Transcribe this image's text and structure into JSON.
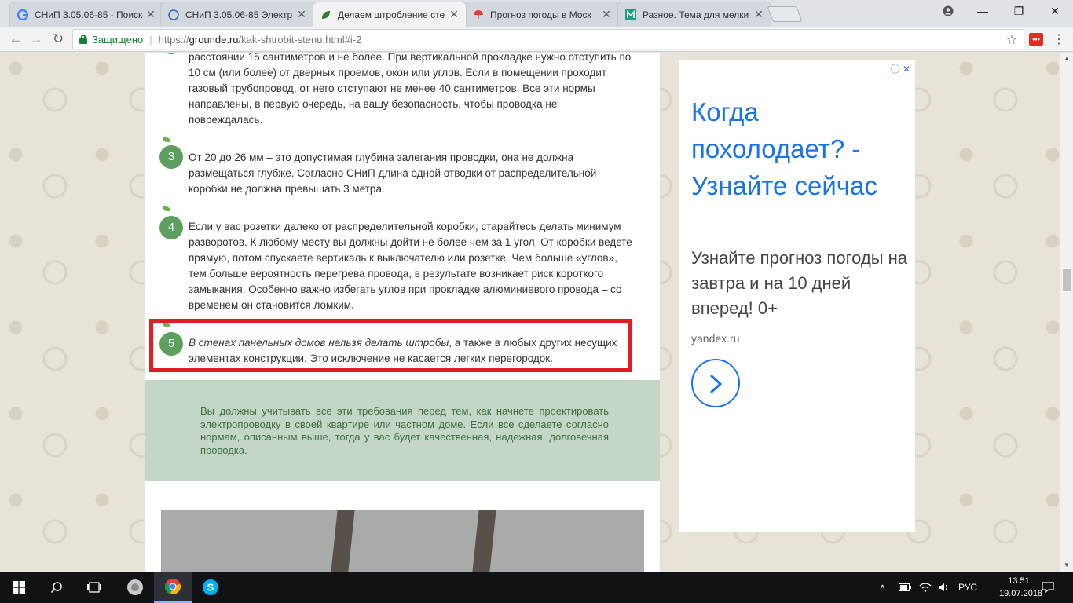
{
  "browser": {
    "tabs": [
      {
        "title": "СНиП 3.05.06-85 - Поиск",
        "icon": "google-icon"
      },
      {
        "title": "СНиП 3.05.06-85 Электр",
        "icon": "compass-icon"
      },
      {
        "title": "Делаем штробление сте",
        "icon": "leaf-icon"
      },
      {
        "title": "Прогноз погоды в Моск",
        "icon": "umbrella-icon"
      },
      {
        "title": "Разное. Тема для мелки",
        "icon": "m-icon"
      }
    ],
    "secure_label": "Защищено",
    "url_scheme": "https://",
    "url_host": "grounde.ru",
    "url_rest": "/kak-shtrobit-stenu.html#i-2"
  },
  "article": {
    "item2_tail": "расстоянии 15 сантиметров и не более. При вертикальной прокладке нужно отступить по 10 см (или более) от дверных проемов, окон или углов. Если в помещении проходит газовый трубопровод, от него отступают не менее 40 сантиметров. Все эти нормы направлены, в первую очередь, на вашу безопасность, чтобы проводка не повреждалась.",
    "items": [
      {
        "number": "3",
        "text": "От 20 до 26 мм – это допустимая глубина залегания проводки, она не должна размещаться глубже. Согласно СНиП длина одной отводки от распределительной коробки не должна превышать 3 метра."
      },
      {
        "number": "4",
        "text": "Если у вас  розетки далеко от распределительной коробки, старайтесь делать минимум разворотов. К любому месту вы должны дойти не более чем за 1 угол. От коробки ведете прямую, потом спускаете вертикаль к выключателю или розетке. Чем больше «углов», тем больше вероятность перегрева провода, в результате возникает риск короткого замыкания. Особенно важно избегать углов при прокладке алюминиевого провода – со временем он становится ломким."
      },
      {
        "number": "5",
        "text_italic": "В стенах панельных домов нельзя делать штробы",
        "text_rest": ", а также в любых других несущих элементах конструкции. Это исключение не касается легких перегородок."
      }
    ],
    "callout": "Вы должны учитывать все эти требования перед тем, как начнете проектировать электропроводку в своей квартире или частном доме. Если все сделаете согласно нормам, описанным выше, тогда у вас будет качественная, надежная, долговечная проводка."
  },
  "ad": {
    "headline": "Когда похолодает? - Узнайте сейчас",
    "body": "Узнайте прогноз погоды на завтра и на 10 дней вперед! 0+",
    "domain": "yandex.ru"
  },
  "taskbar": {
    "lang": "РУС",
    "time": "13:51",
    "date": "19.07.2018"
  },
  "colors": {
    "accent_red": "#e31b23",
    "number_green": "#5c9f5f",
    "callout_bg": "#c4d7c6",
    "ad_blue": "#1a73e8"
  }
}
